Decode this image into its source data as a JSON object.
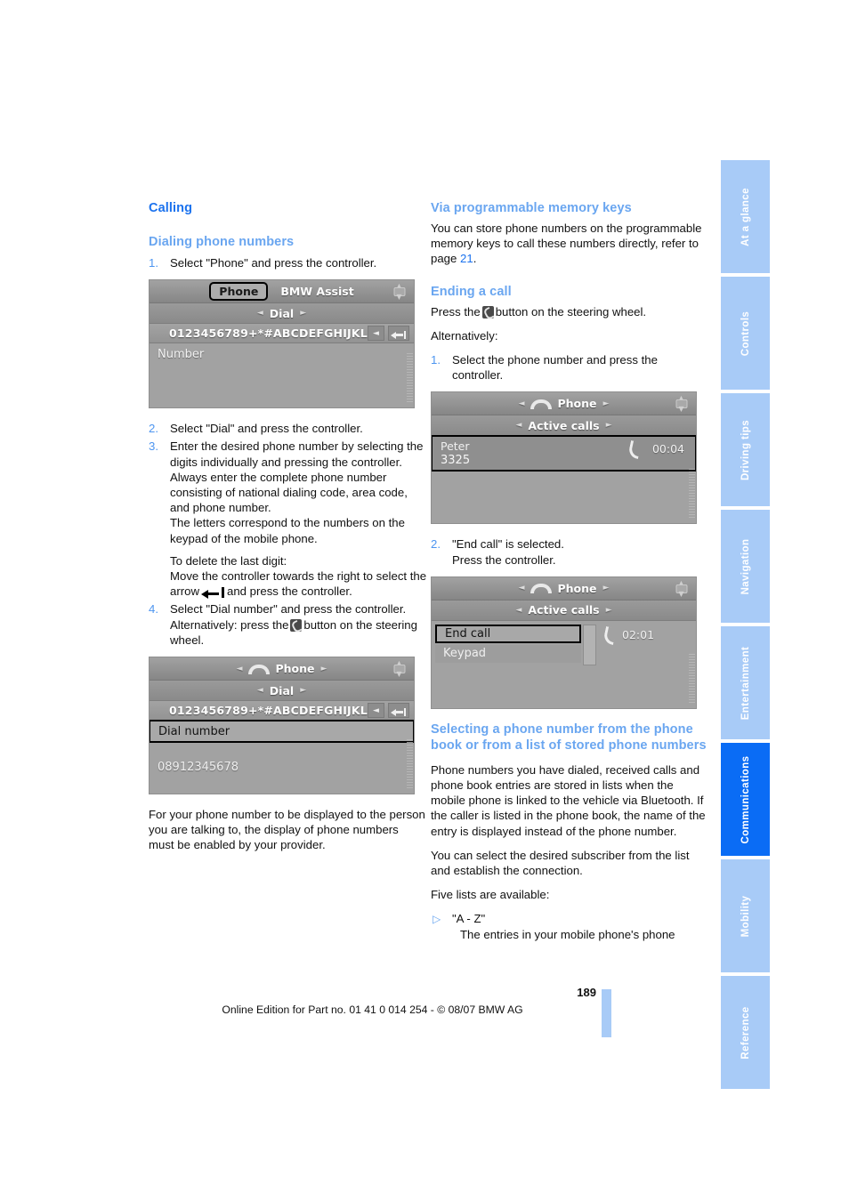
{
  "left_column": {
    "section_title": "Calling",
    "subsection_title": "Dialing phone numbers",
    "step1": {
      "num": "1.",
      "text": "Select \"Phone\" and press the controller."
    },
    "screenshot1": {
      "tab_active": "Phone",
      "tab_other": "BMW Assist",
      "menu": "Dial",
      "letters": "0123456789+*#ABCDEFGHIJKL",
      "field_label": "Number"
    },
    "step2": {
      "num": "2.",
      "text": "Select \"Dial\" and press the controller."
    },
    "step3": {
      "num": "3.",
      "line1": "Enter the desired phone number by selecting the digits individually and pressing the controller.",
      "line2": "Always enter the complete phone number consisting of national dialing code, area code, and phone number.",
      "line3": "The letters correspond to the numbers on the keypad of the mobile phone.",
      "line4": "To delete the last digit:",
      "line5a": "Move the controller towards the right to select the arrow",
      "line5b": "and press the controller."
    },
    "step4": {
      "num": "4.",
      "line1": "Select \"Dial number\" and press the controller.",
      "line2a": "Alternatively: press the",
      "line2b": "button on the steering wheel."
    },
    "screenshot2": {
      "title": "Phone",
      "menu": "Dial",
      "letters": "0123456789+*#ABCDEFGHIJKL",
      "selected_row": "Dial number",
      "number": "08912345678"
    },
    "closing_paragraph": "For your phone number to be displayed to the person you are talking to, the display of phone numbers must be enabled by your provider."
  },
  "right_column": {
    "memory_keys": {
      "heading": "Via programmable memory keys",
      "text_before": "You can store phone numbers on the programmable memory keys to call these numbers directly, refer to page ",
      "page_ref": "21",
      "text_after": "."
    },
    "ending_call": {
      "heading": "Ending a call",
      "press_before": "Press the",
      "press_after": "button on the steering wheel.",
      "alternatively": "Alternatively:",
      "step1_num": "1.",
      "step1_text": "Select the phone number and press the controller."
    },
    "screenshot3": {
      "title": "Phone",
      "menu": "Active calls",
      "caller_name": "Peter",
      "caller_number": "3325",
      "duration": "00:04"
    },
    "step2": {
      "num": "2.",
      "line1": "\"End call\" is selected.",
      "line2": "Press the controller."
    },
    "screenshot4": {
      "title": "Phone",
      "menu": "Active calls",
      "row1": "End call",
      "row2": "Keypad",
      "duration": "02:01"
    },
    "phonebook": {
      "heading": "Selecting a phone number from the phone book or from a list of stored phone numbers",
      "para1": "Phone numbers you have dialed, received calls and phone book entries are stored in lists when the mobile phone is linked to the vehicle via Bluetooth. If the caller is listed in the phone book, the name of the entry is displayed instead of the phone number.",
      "para2": "You can select the desired subscriber from the list and establish the connection.",
      "para3": "Five lists are available:",
      "bullet1_title": "\"A - Z\"",
      "bullet1_text": "The entries in your mobile phone's phone"
    }
  },
  "index_tabs": [
    {
      "label": "At a glance",
      "active": false
    },
    {
      "label": "Controls",
      "active": false
    },
    {
      "label": "Driving tips",
      "active": false
    },
    {
      "label": "Navigation",
      "active": false
    },
    {
      "label": "Entertainment",
      "active": false
    },
    {
      "label": "Communications",
      "active": true
    },
    {
      "label": "Mobility",
      "active": false
    },
    {
      "label": "Reference",
      "active": false
    }
  ],
  "footer": {
    "page_number": "189",
    "imprint": "Online Edition for Part no. 01 41 0 014 254 - © 08/07 BMW AG"
  },
  "colors": {
    "heading_primary": "#1b72ee",
    "heading_secondary": "#6aa6f0",
    "tab_inactive": "#a8cbf7",
    "tab_active": "#0a6cf5"
  }
}
